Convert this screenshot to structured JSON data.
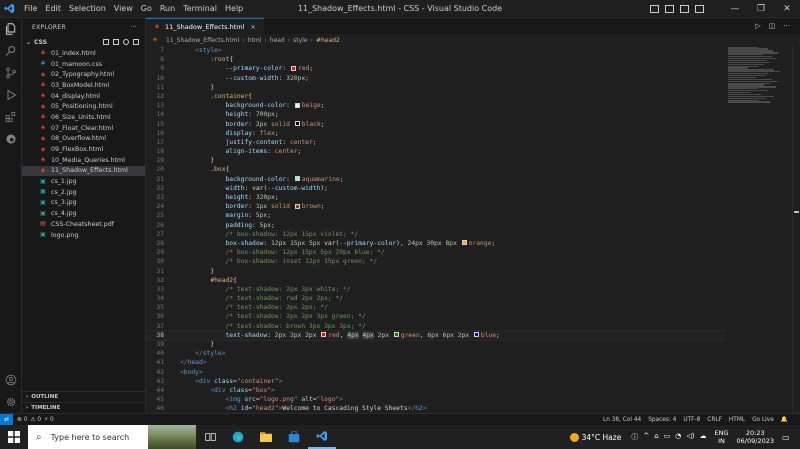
{
  "titlebar": {
    "menu": [
      "File",
      "Edit",
      "Selection",
      "View",
      "Go",
      "Run",
      "Terminal",
      "Help"
    ],
    "title": "11_Shadow_Effects.html - CSS - Visual Studio Code",
    "accent": "#0078d4"
  },
  "sidebar": {
    "header": "EXPLORER",
    "more": "···",
    "folder": "CSS",
    "files": [
      {
        "name": "01_index.html",
        "type": "html"
      },
      {
        "name": "01_mamoon.css",
        "type": "css"
      },
      {
        "name": "02_Typography.html",
        "type": "html"
      },
      {
        "name": "03_BoxModel.html",
        "type": "html"
      },
      {
        "name": "04_display.html",
        "type": "html"
      },
      {
        "name": "05_Positioning.html",
        "type": "html"
      },
      {
        "name": "06_Size_Units.html",
        "type": "html"
      },
      {
        "name": "07_Float_Clear.html",
        "type": "html"
      },
      {
        "name": "08_Overflow.html",
        "type": "html"
      },
      {
        "name": "09_FlexBox.html",
        "type": "html"
      },
      {
        "name": "10_Media_Queries.html",
        "type": "html"
      },
      {
        "name": "11_Shadow_Effects.html",
        "type": "html",
        "active": true
      },
      {
        "name": "cs_1.jpg",
        "type": "img"
      },
      {
        "name": "cs_2.jpg",
        "type": "img"
      },
      {
        "name": "cs_3.jpg",
        "type": "img"
      },
      {
        "name": "cs_4.jpg",
        "type": "img"
      },
      {
        "name": "CSS-Cheatsheet.pdf",
        "type": "pdf"
      },
      {
        "name": "logo.png",
        "type": "img"
      }
    ],
    "outline": "OUTLINE",
    "timeline": "TIMELINE"
  },
  "editor": {
    "tab": "11_Shadow_Effects.html",
    "breadcrumbs": [
      "11_Shadow_Effects.html",
      "html",
      "head",
      "style",
      "#head2"
    ],
    "current_line": 38
  },
  "statusbar": {
    "left": [
      "⊗ 0",
      "⚠ 0",
      "⚡ 0"
    ],
    "right": [
      "Ln 38, Col 44",
      "Spaces: 4",
      "UTF-8",
      "CRLF",
      "HTML",
      "Go Live",
      "🔔"
    ]
  },
  "taskbar": {
    "search_placeholder": "Type here to search",
    "weather": "34°C  Haze",
    "lang_top": "ENG",
    "lang_bottom": "IN",
    "time": "20:23",
    "date": "06/09/2023"
  }
}
